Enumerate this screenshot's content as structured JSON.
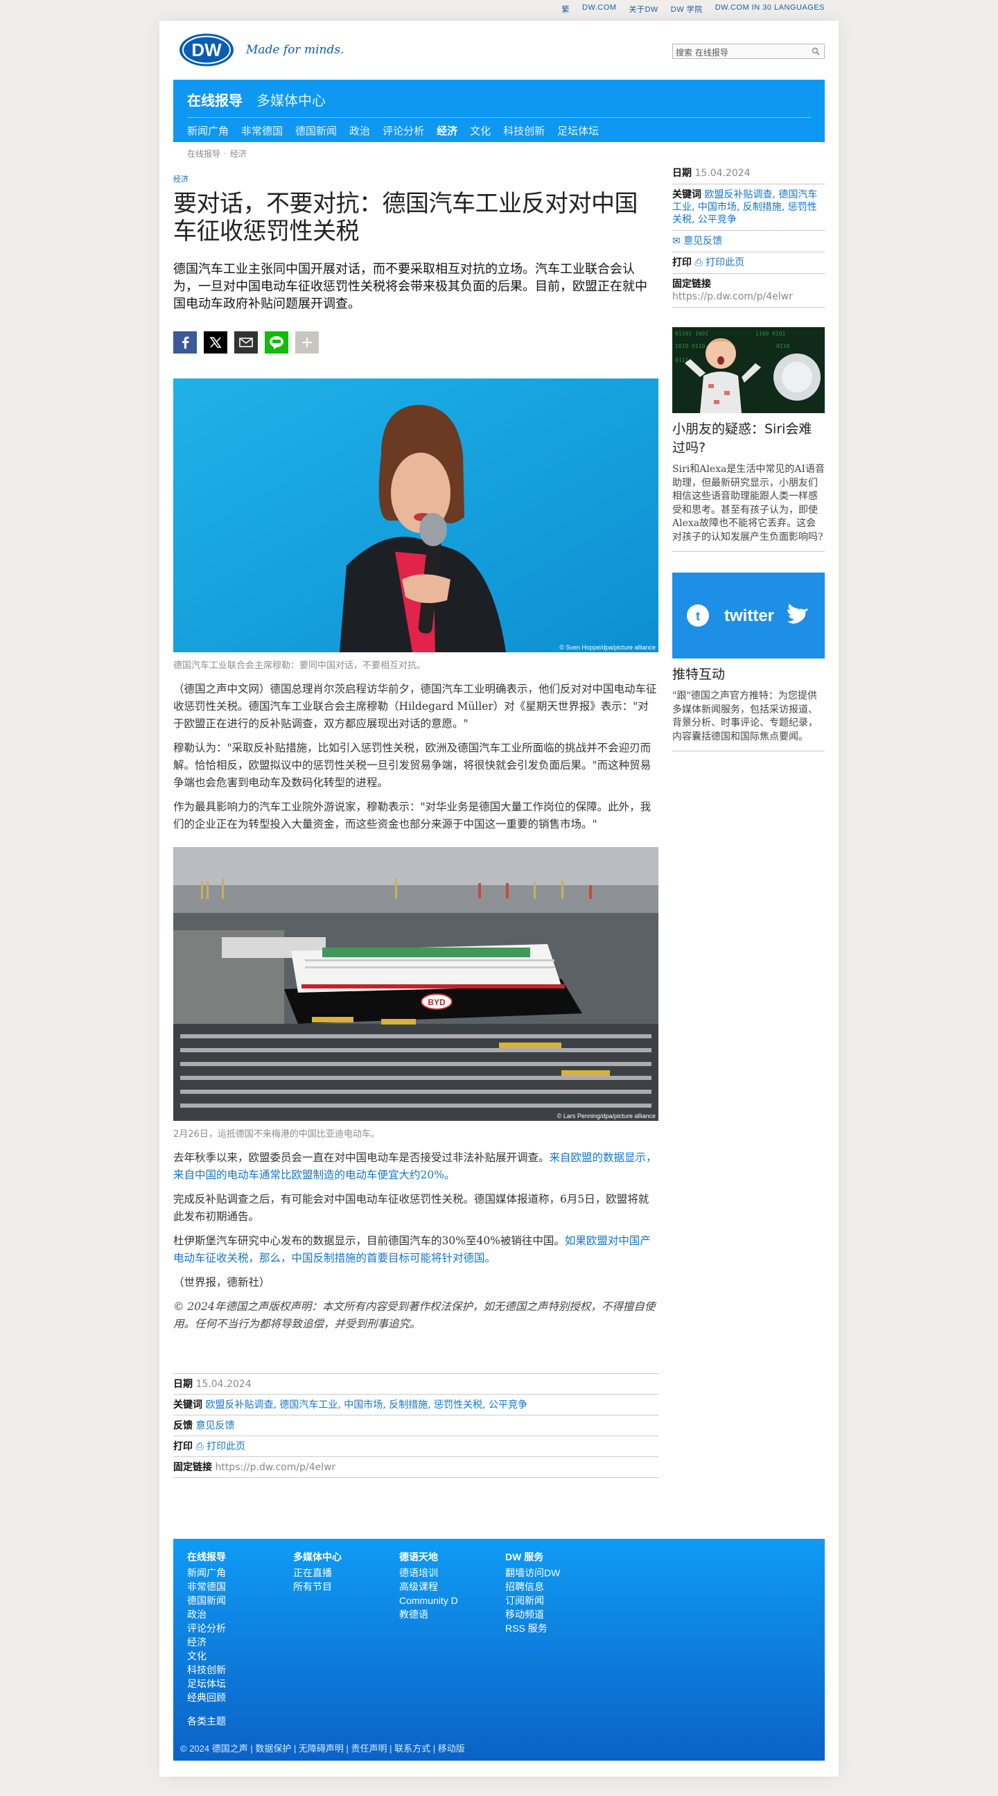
{
  "topbar": [
    "繁",
    "DW.COM",
    "关于DW",
    "DW 学院",
    "DW.COM IN 30 LANGUAGES"
  ],
  "header": {
    "logo_text": "DW",
    "slogan": "Made for minds.",
    "search_placeholder": "搜索 在线报导"
  },
  "nav": {
    "primary": [
      "在线报导",
      "多媒体中心"
    ],
    "secondary": [
      "新闻广角",
      "非常德国",
      "德国新闻",
      "政治",
      "评论分析",
      "经济",
      "文化",
      "科技创新",
      "足坛体坛"
    ],
    "active_secondary": "经济"
  },
  "breadcrumb": [
    "在线报导",
    "经济"
  ],
  "article": {
    "kicker": "经济",
    "title": "要对话，不要对抗：德国汽车工业反对对中国车征收惩罚性关税",
    "lead": "德国汽车工业主张同中国开展对话，而不要采取相互对抗的立场。汽车工业联合会认为，一旦对中国电动车征收惩罚性关税将会带来极其负面的后果。目前，欧盟正在就中国电动车政府补贴问题展开调查。",
    "photo1_credit": "© Sven Hoppe/dpa/picture alliance",
    "photo1_caption": "德国汽车工业联合会主席穆勒：要同中国对话，不要相互对抗。",
    "p1": "（德国之声中文网）德国总理肖尔茨启程访华前夕，德国汽车工业明确表示，他们反对对中国电动车征收惩罚性关税。德国汽车工业联合会主席穆勒（Hildegard Müller）对《星期天世界报》表示：\"对于欧盟正在进行的反补贴调查，双方都应展现出对话的意愿。\"",
    "p2": "穆勒认为：\"采取反补贴措施，比如引入惩罚性关税，欧洲及德国汽车工业所面临的挑战并不会迎刃而解。恰恰相反，欧盟拟议中的惩罚性关税一旦引发贸易争端，将很快就会引发负面后果。\"而这种贸易争端也会危害到电动车及数码化转型的进程。",
    "p3": "作为最具影响力的汽车工业院外游说家，穆勒表示：\"对华业务是德国大量工作岗位的保障。此外，我们的企业正在为转型投入大量资金，而这些资金也部分来源于中国这一重要的销售市场。\"",
    "photo2_credit": "© Lars Penning/dpa/picture alliance",
    "photo2_caption": "2月26日，运抵德国不来梅港的中国比亚迪电动车。",
    "p4_text": "去年秋季以来，欧盟委员会一直在对中国电动车是否接受过非法补贴展开调查。",
    "p4_link": "来自欧盟的数据显示，来自中国的电动车通常比欧盟制造的电动车便宜大约20%。",
    "p5": "完成反补贴调查之后，有可能会对中国电动车征收惩罚性关税。德国媒体报道称，6月5日，欧盟将就此发布初期通告。",
    "p6_text": "杜伊斯堡汽车研究中心发布的数据显示，目前德国汽车的30%至40%被销往中国。",
    "p6_link": "如果欧盟对中国产电动车征收关税，那么，中国反制措施的首要目标可能将针对德国。",
    "source": "（世界报，德新社）",
    "copyright": "© 2024年德国之声版权声明：本文所有内容受到著作权法保护，如无德国之声特别授权，不得擅自使用。任何不当行为都将导致追偿，并受到刑事追究。",
    "ship_label": "BYD"
  },
  "meta": {
    "date_label": "日期",
    "date": "15.04.2024",
    "keywords_label": "关键词",
    "keywords": "欧盟反补贴调查, 德国汽车工业, 中国市场, 反制措施, 惩罚性关税, 公平竞争",
    "feedback_label": "反馈",
    "feedback": "意见反馈",
    "print_label": "打印",
    "print": "打印此页",
    "permalink_label": "固定链接",
    "permalink": "https://p.dw.com/p/4elwr"
  },
  "sidebar": {
    "date_label": "日期",
    "date": "15.04.2024",
    "keywords_label": "关键词",
    "keywords": "欧盟反补贴调查, 德国汽车工业, 中国市场, 反制措施, 惩罚性关税, 公平竞争",
    "feedback": "意见反馈",
    "print_label": "打印",
    "print": "打印此页",
    "permalink_label": "固定链接",
    "permalink": "https://p.dw.com/p/4elwr",
    "teaser1_title": "小朋友的疑惑：Siri会难过吗?",
    "teaser1_text": "Siri和Alexa是生活中常见的AI语音助理，但最新研究显示，小朋友们相信这些语音助理能跟人类一样感受和思考。甚至有孩子认为，即使Alexa故障也不能将它丢弃。这会对孩子的认知发展产生负面影响吗?",
    "teaser2_logo": "twitter",
    "teaser2_title": "推特互动",
    "teaser2_text": "\"跟\"德国之声官方推特：为您提供多媒体新闻服务，包括采访报道、背景分析、时事评论、专题纪录，内容囊括德国和国际焦点要闻。"
  },
  "footer": {
    "columns": [
      {
        "title": "在线报导",
        "items": [
          "新闻广角",
          "非常德国",
          "德国新闻",
          "政治",
          "评论分析",
          "经济",
          "文化",
          "科技创新",
          "足坛体坛",
          "经典回顾"
        ]
      },
      {
        "title": "多媒体中心",
        "items": [
          "正在直播",
          "所有节目"
        ]
      },
      {
        "title": "德语天地",
        "items": [
          "德语培训",
          "高级课程",
          "Community D",
          "教德语"
        ]
      },
      {
        "title": "DW 服务",
        "items": [
          "翻墙访问DW",
          "招聘信息",
          "订阅新闻",
          "移动频道",
          "RSS 服务"
        ]
      }
    ],
    "themes": "各类主题",
    "bottom": "© 2024 德国之声 | 数据保护 | 无障碍声明 | 责任声明 | 联系方式 | 移动版"
  },
  "colors": {
    "brand_blue": "#0f98f2",
    "link": "#1375c9",
    "logo_blue": "#0a5db3"
  }
}
